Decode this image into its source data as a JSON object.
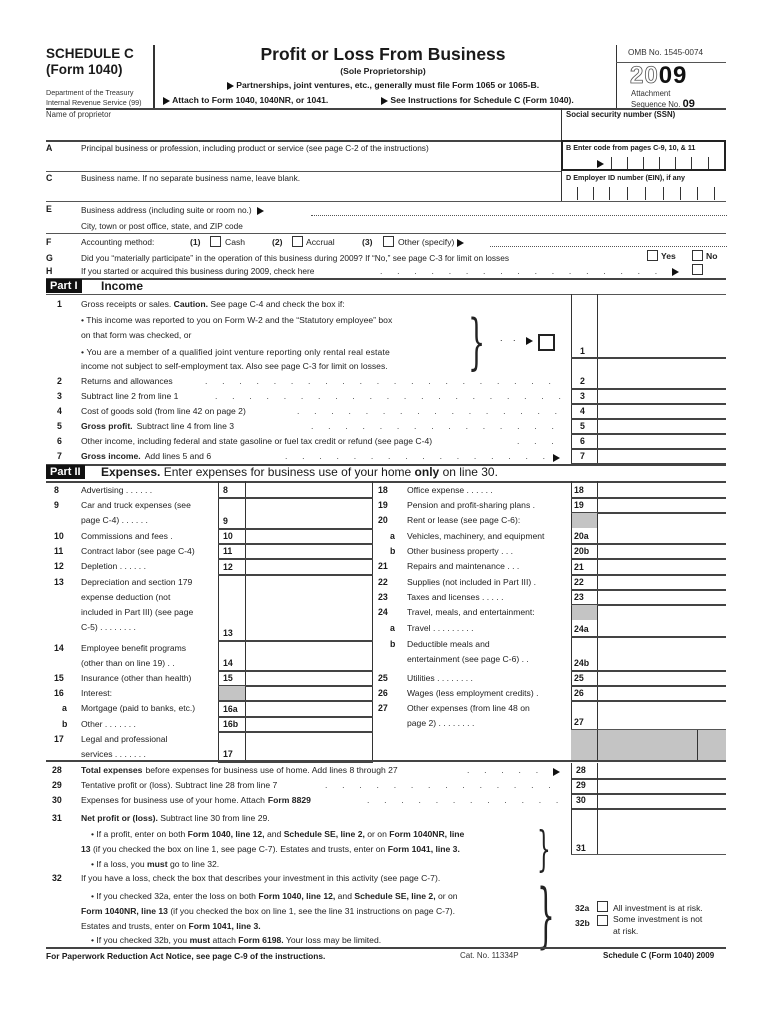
{
  "header": {
    "schedule": "SCHEDULE C",
    "form": "(Form 1040)",
    "dept1": "Department of the Treasury",
    "dept2": "Internal Revenue Service (99)",
    "title": "Profit or Loss From Business",
    "subtitle": "(Sole Proprietorship)",
    "instruction1": "Partnerships, joint ventures, etc., generally must file Form 1065 or 1065-B.",
    "instruction2": "Attach to Form 1040, 1040NR, or 1041.",
    "instruction3": "See Instructions for Schedule C (Form 1040).",
    "omb": "OMB No. 1545-0074",
    "year_outline": "20",
    "year_bold": "09",
    "attachment": "Attachment",
    "sequence": "Sequence No.",
    "sequence_no": "09"
  },
  "name_row": {
    "name_label": "Name of proprietor",
    "name_value": "",
    "ssn_label": "Social security number (SSN)",
    "ssn_value": ""
  },
  "lines_top": {
    "A": {
      "letter": "A",
      "label": "Principal business or profession, including product or service (see page C-2 of the instructions)",
      "value": ""
    },
    "B": {
      "letter": "B",
      "label": "Enter code from pages C-9, 10, & 11"
    },
    "C": {
      "letter": "C",
      "label": "Business name. If no separate business name, leave blank.",
      "value": ""
    },
    "D": {
      "letter": "D",
      "label": "Employer ID number (EIN), if any"
    },
    "E": {
      "letter": "E",
      "label": "Business address (including suite or room no.)",
      "label2": "City, town or post office, state, and ZIP code",
      "value": "",
      "value2": ""
    },
    "F": {
      "letter": "F",
      "label": "Accounting method:",
      "opt1_num": "(1)",
      "opt1": "Cash",
      "opt2_num": "(2)",
      "opt2": "Accrual",
      "opt3_num": "(3)",
      "opt3": "Other (specify)",
      "other_value": ""
    },
    "G": {
      "letter": "G",
      "label": "Did you “materially participate” in the operation of this business during 2009? If “No,” see page C-3 for limit on losses",
      "yes": "Yes",
      "no": "No"
    },
    "H": {
      "letter": "H",
      "label": "If you started or acquired this business during 2009, check here"
    }
  },
  "part1": {
    "tag": "Part I",
    "title": "Income",
    "line1": {
      "num": "1",
      "text_a": "Gross receipts or sales.",
      "caution": "Caution.",
      "text_b": "See page C-4 and check the box if:",
      "bullet1a": "• This income was reported to you on Form W-2 and the “Statutory employee” box",
      "bullet1b": "on that form was checked, or",
      "bullet2a": "• You are a member of a qualified joint venture reporting only rental real estate",
      "bullet2b": "income not subject to self-employment tax. Also see page C-3 for limit on losses.",
      "box": "1"
    },
    "lines": [
      {
        "num": "2",
        "bold": "",
        "text": "Returns and allowances",
        "box": "2",
        "arrow": false
      },
      {
        "num": "3",
        "bold": "",
        "text": "Subtract line 2 from line 1",
        "box": "3",
        "arrow": false
      },
      {
        "num": "4",
        "bold": "",
        "text": "Cost of goods sold (from line 42 on page 2)",
        "box": "4",
        "arrow": false
      },
      {
        "num": "5",
        "bold": "Gross profit.",
        "text": "Subtract line 4 from line 3",
        "box": "5",
        "arrow": false
      },
      {
        "num": "6",
        "bold": "",
        "text": "Other income, including federal and state gasoline or fuel tax credit or refund (see page C-4)",
        "box": "6",
        "arrow": false
      },
      {
        "num": "7",
        "bold": "Gross income.",
        "text": "Add lines 5 and 6",
        "box": "7",
        "arrow": true
      }
    ]
  },
  "part2": {
    "tag": "Part II",
    "title_bold": "Expenses.",
    "title_rest": "Enter expenses for business use of your home",
    "title_only": "only",
    "title_end": "on line 30.",
    "left": [
      {
        "num": "8",
        "text": "Advertising . . . . . .",
        "box": "8"
      },
      {
        "num": "9",
        "text": "Car and truck expenses (see",
        "text2": "page C-4) . . . . . .",
        "box": "9"
      },
      {
        "num": "10",
        "text": "Commissions and fees .",
        "box": "10"
      },
      {
        "num": "11",
        "text": "Contract labor (see page C-4)",
        "box": "11"
      },
      {
        "num": "12",
        "text": "Depletion . . . . . .",
        "box": "12"
      },
      {
        "num": "13",
        "text": "Depreciation and section 179",
        "text2": "expense deduction (not",
        "text3": "included in Part III) (see page",
        "text4": "C-5) . . . . . . . .",
        "box": "13"
      },
      {
        "num": "14",
        "text": "Employee benefit programs",
        "text2": "(other than on line 19) . .",
        "box": "14"
      },
      {
        "num": "15",
        "text": "Insurance (other than health)",
        "box": "15"
      },
      {
        "num": "16",
        "text": "Interest:",
        "box": ""
      },
      {
        "num": "a",
        "text": "Mortgage (paid to banks, etc.)",
        "box": "16a"
      },
      {
        "num": "b",
        "text": "Other . . . . . . .",
        "box": "16b"
      },
      {
        "num": "17",
        "text": "Legal and professional",
        "text2": "services . . . . . . .",
        "box": "17"
      }
    ],
    "right": [
      {
        "num": "18",
        "text": "Office expense . . . . . .",
        "box": "18"
      },
      {
        "num": "19",
        "text": "Pension and profit-sharing plans .",
        "box": "19"
      },
      {
        "num": "20",
        "text": "Rent or lease (see page C-6):",
        "box": ""
      },
      {
        "num": "a",
        "text": "Vehicles, machinery, and equipment",
        "box": "20a"
      },
      {
        "num": "b",
        "text": "Other business property . . .",
        "box": "20b"
      },
      {
        "num": "21",
        "text": "Repairs and maintenance . . .",
        "box": "21"
      },
      {
        "num": "22",
        "text": "Supplies (not included in Part III) .",
        "box": "22"
      },
      {
        "num": "23",
        "text": "Taxes and licenses . . . . .",
        "box": "23"
      },
      {
        "num": "24",
        "text": "Travel, meals, and entertainment:",
        "box": ""
      },
      {
        "num": "a",
        "text": "Travel . . . . . . . . .",
        "box": "24a"
      },
      {
        "num": "b",
        "text": "Deductible meals and",
        "text2": "entertainment (see page C-6) . .",
        "box": "24b"
      },
      {
        "num": "25",
        "text": "Utilities . . . . . . . .",
        "box": "25"
      },
      {
        "num": "26",
        "text": "Wages (less employment credits) .",
        "box": "26"
      },
      {
        "num": "27",
        "text": "Other expenses (from line 48 on",
        "text2": "page 2) . . . . . . . .",
        "box": "27"
      }
    ],
    "bottom": [
      {
        "num": "28",
        "bold": "Total expenses",
        "text": "before expenses for business use of home. Add lines 8 through 27",
        "box": "28",
        "arrow": true
      },
      {
        "num": "29",
        "bold": "",
        "text": "Tentative profit or (loss). Subtract line 28 from line 7",
        "box": "29",
        "arrow": false
      },
      {
        "num": "30",
        "bold": "",
        "text": "Expenses for business use of your home. Attach",
        "bold2": "Form 8829",
        "box": "30",
        "arrow": false
      }
    ],
    "line31": {
      "num": "31",
      "bold": "Net profit or (loss).",
      "text": "Subtract line 30 from line 29.",
      "b1_a": "•  If a profit, enter on both ",
      "b1_b": "Form 1040, line 12,",
      "b1_c": " and ",
      "b1_d": "Schedule SE, line 2,",
      "b1_e": " or on ",
      "b1_f": "Form 1040NR, line",
      "b2_a": "13",
      "b2_b": " (if you checked the box on line 1, see page C-7). Estates and trusts, enter on ",
      "b2_c": "Form 1041, line 3.",
      "b3_a": "•  If a loss, you ",
      "b3_b": "must",
      "b3_c": "  go to line 32.",
      "box": "31"
    },
    "line32": {
      "num": "32",
      "text": "If you have a loss, check the box that describes your investment in this activity (see page C-7).",
      "b1_a": "•  If you checked 32a, enter the loss on both ",
      "b1_b": "Form 1040, line 12,",
      "b1_c": " and ",
      "b1_d": "Schedule SE, line 2,",
      "b1_e": " or on",
      "b2_a": "Form 1040NR, line 13",
      "b2_b": " (if you checked the box on line 1, see the line 31 instructions on page C-7).",
      "b3_a": "Estates and trusts, enter on ",
      "b3_b": "Form 1041, line 3.",
      "b4_a": "•  If you checked 32b, you ",
      "b4_b": "must",
      "b4_c": " attach ",
      "b4_d": "Form 6198.",
      "b4_e": " Your loss may be limited.",
      "opt_a_label": "32a",
      "opt_a": "All investment is at risk.",
      "opt_b_label": "32b",
      "opt_b1": "Some investment is not",
      "opt_b2": "at risk."
    }
  },
  "footer": {
    "notice": "For Paperwork Reduction Act Notice, see page C-9 of the instructions.",
    "cat": "Cat. No. 11334P",
    "form_id": "Schedule C (Form 1040) 2009"
  },
  "colors": {
    "shade": "#c4c4c4",
    "part_tag_bg": "#111111"
  }
}
